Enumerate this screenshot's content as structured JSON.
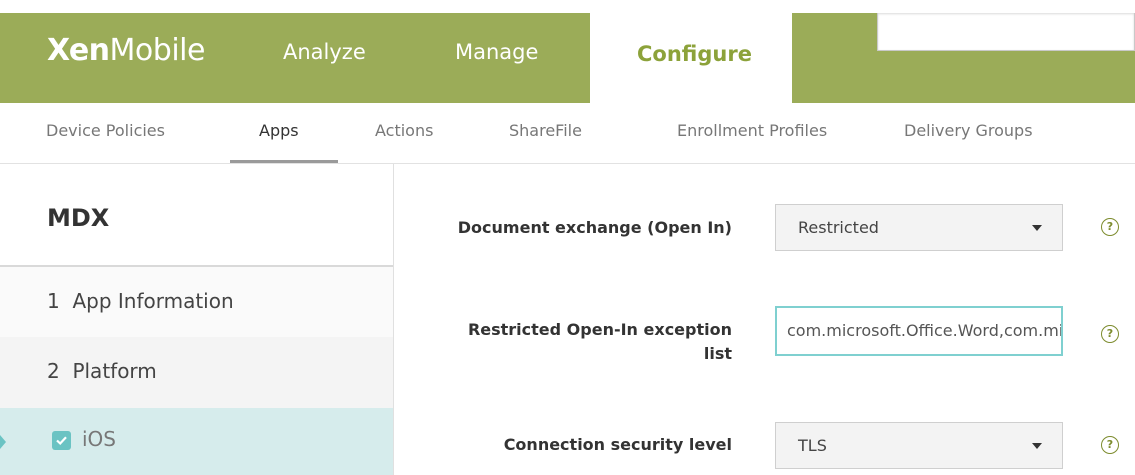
{
  "header": {
    "logo_bold": "Xen",
    "logo_light": "Mobile",
    "nav": [
      "Analyze",
      "Manage",
      "Configure"
    ],
    "active_nav": "Configure",
    "search_value": ""
  },
  "subnav": {
    "items": [
      "Device Policies",
      "Apps",
      "Actions",
      "ShareFile",
      "Enrollment Profiles",
      "Delivery Groups"
    ],
    "active": "Apps"
  },
  "sidebar": {
    "title": "MDX",
    "items": [
      {
        "label": "1  App Information"
      },
      {
        "label": "2  Platform"
      },
      {
        "label": "iOS",
        "checked": true
      }
    ]
  },
  "form": {
    "doc_exchange_label": "Document exchange (Open In)",
    "doc_exchange_value": "Restricted",
    "exception_label_line1": "Restricted Open-In exception",
    "exception_label_line2": "list",
    "exception_value": "com.microsoft.Office.Word,com.microsoft.Office.Excel",
    "conn_security_label": "Connection security level",
    "conn_security_value": "TLS",
    "help_glyph": "?"
  },
  "colors": {
    "header_green": "#9bac58",
    "active_nav_text": "#8ca23a",
    "ios_selected_bg": "#d6ecec",
    "checkbox": "#6bc3c3",
    "input_focus_border": "#7fd0d0"
  },
  "icons": {
    "select_caret": "chevron-down-icon",
    "help": "help-circle-icon",
    "checkbox": "checkbox-checked-icon"
  }
}
